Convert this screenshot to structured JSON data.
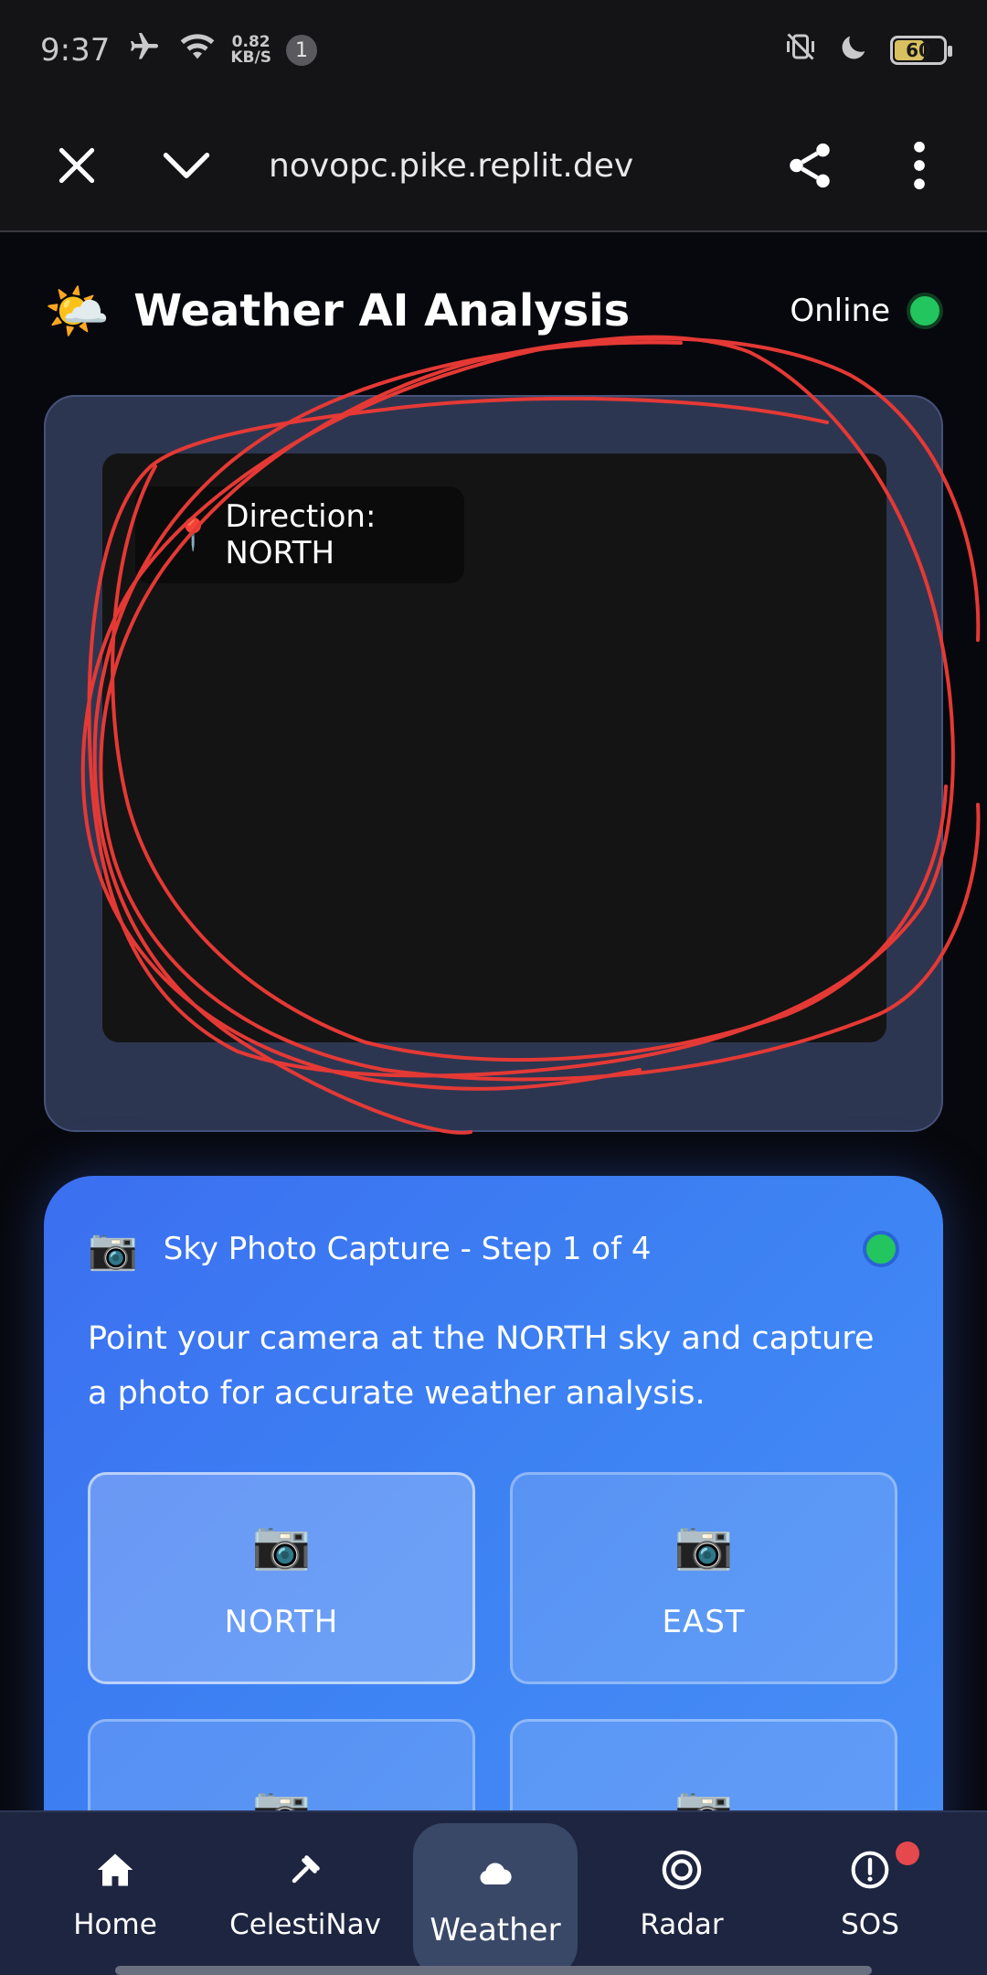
{
  "status_bar": {
    "time": "9:37",
    "net_speed_value": "0.82",
    "net_speed_unit": "KB/S",
    "notification_count": "1",
    "battery_level": "60",
    "icons": [
      "airplane-icon",
      "wifi-icon",
      "vibrate-off-icon",
      "moon-icon",
      "battery-icon"
    ]
  },
  "browser": {
    "url": "novopc.pike.replit.dev",
    "icons": [
      "close-icon",
      "chevron-down-icon",
      "share-icon",
      "more-vert-icon"
    ]
  },
  "app_header": {
    "logo": "🌤️",
    "title": "Weather AI Analysis",
    "status_label": "Online",
    "status_color": "#22c55e"
  },
  "preview": {
    "direction_icon": "📍",
    "direction_label": "Direction: NORTH"
  },
  "capture": {
    "icon": "📷",
    "title": "Sky Photo Capture - Step 1 of 4",
    "description": "Point your camera at the NORTH sky and capture a photo for accurate weather analysis.",
    "directions": [
      {
        "label": "NORTH",
        "icon": "📷"
      },
      {
        "label": "EAST",
        "icon": "📷"
      },
      {
        "label": "",
        "icon": "📷"
      },
      {
        "label": "",
        "icon": "📷"
      }
    ]
  },
  "bottom_nav": {
    "items": [
      {
        "label": "Home",
        "icon": "home-icon"
      },
      {
        "label": "CelestiNav",
        "icon": "sextant-icon"
      },
      {
        "label": "Weather",
        "icon": "cloud-icon"
      },
      {
        "label": "Radar",
        "icon": "radar-icon"
      },
      {
        "label": "SOS",
        "icon": "alert-icon"
      }
    ],
    "active": "Weather"
  },
  "colors": {
    "accent_blue": "#3d82f3",
    "annotation_red": "#e53935"
  }
}
